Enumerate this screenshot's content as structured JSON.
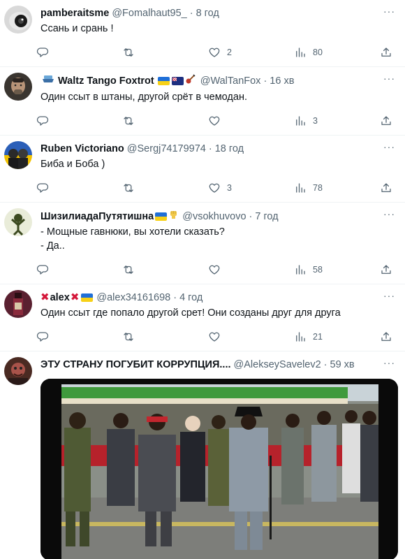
{
  "tweets": [
    {
      "name": "pamberaitsme",
      "handle": "@Fomalhaut95_",
      "time": "8 год",
      "lines": [
        "Ссань и срань !"
      ],
      "replies": "",
      "retweets": "",
      "likes": "2",
      "views": "80"
    },
    {
      "name": "Waltz Tango Foxtrot",
      "handle": "@WalTanFox",
      "time": "16 хв",
      "lines": [
        "Один ссыт в штаны, другой срёт в чемодан."
      ],
      "replies": "",
      "retweets": "",
      "likes": "",
      "views": "3"
    },
    {
      "name": "Ruben Victoriano",
      "handle": "@Sergj74179974",
      "time": "18 год",
      "lines": [
        "Биба и Боба )"
      ],
      "replies": "",
      "retweets": "",
      "likes": "3",
      "views": "78"
    },
    {
      "name": "ШизилиадаПутятишна",
      "handle": "@vsokhuvovo",
      "time": "7 год",
      "lines": [
        "- Мощные гавнюки, вы хотели сказать?",
        "- Да.."
      ],
      "replies": "",
      "retweets": "",
      "likes": "",
      "views": "58"
    },
    {
      "name": "alex",
      "handle": "@alex34161698",
      "time": "4 год",
      "lines": [
        "Один ссыт где попало другой срет! Они созданы друг для друга"
      ],
      "replies": "",
      "retweets": "",
      "likes": "",
      "views": "21"
    },
    {
      "name": "ЭТУ СТРАНУ ПОГУБИТ КОРРУПЦИЯ....",
      "handle": "@AlekseySavelev2",
      "time": "59 хв",
      "lines": [],
      "replies": "",
      "retweets": "",
      "likes": "",
      "views": ""
    }
  ],
  "icons": {
    "reply": "reply-icon",
    "retweet": "retweet-icon",
    "like": "heart-icon",
    "views": "analytics-icon",
    "share": "share-icon",
    "more": "more-icon"
  },
  "colors": {
    "text": "#0f1419",
    "secondary": "#536471",
    "divider": "#eff3f4",
    "flag_blue": "#1f6fd8",
    "flag_yellow": "#f7d117",
    "x_red": "#d4173a"
  }
}
